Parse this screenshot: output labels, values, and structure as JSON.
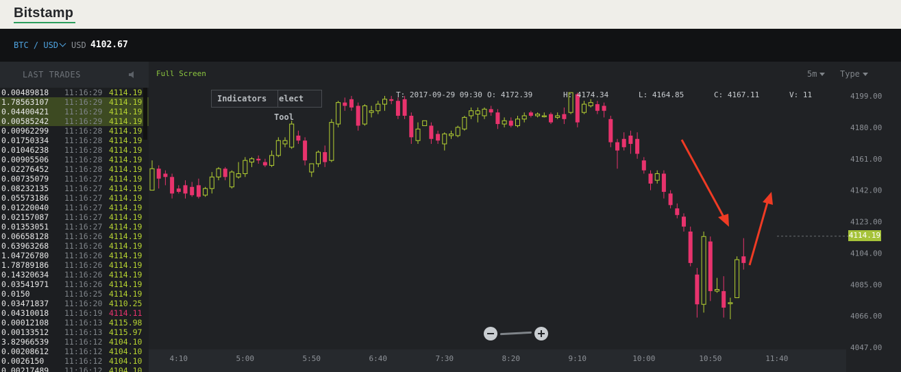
{
  "header": {
    "logo": "Bitstamp"
  },
  "pair_bar": {
    "pair": "BTC / USD",
    "currency": "USD",
    "price": "4102.67"
  },
  "last_trades": {
    "title": "LAST TRADES",
    "rows": [
      {
        "amount": "0.00489818",
        "time": "11:16:29",
        "price": "4114.19",
        "dir": "up",
        "highlight": false
      },
      {
        "amount": "1.78563107",
        "time": "11:16:29",
        "price": "4114.19",
        "dir": "up",
        "highlight": true
      },
      {
        "amount": "0.04400421",
        "time": "11:16:29",
        "price": "4114.19",
        "dir": "up",
        "highlight": true
      },
      {
        "amount": "0.00585242",
        "time": "11:16:29",
        "price": "4114.19",
        "dir": "up",
        "highlight": true
      },
      {
        "amount": "0.00962299",
        "time": "11:16:28",
        "price": "4114.19",
        "dir": "up",
        "highlight": false
      },
      {
        "amount": "0.01750334",
        "time": "11:16:28",
        "price": "4114.19",
        "dir": "up",
        "highlight": false
      },
      {
        "amount": "0.01046238",
        "time": "11:16:28",
        "price": "4114.19",
        "dir": "up",
        "highlight": false
      },
      {
        "amount": "0.00905506",
        "time": "11:16:28",
        "price": "4114.19",
        "dir": "up",
        "highlight": false
      },
      {
        "amount": "0.02276452",
        "time": "11:16:28",
        "price": "4114.19",
        "dir": "up",
        "highlight": false
      },
      {
        "amount": "0.00735079",
        "time": "11:16:27",
        "price": "4114.19",
        "dir": "up",
        "highlight": false
      },
      {
        "amount": "0.08232135",
        "time": "11:16:27",
        "price": "4114.19",
        "dir": "up",
        "highlight": false
      },
      {
        "amount": "0.05573186",
        "time": "11:16:27",
        "price": "4114.19",
        "dir": "up",
        "highlight": false
      },
      {
        "amount": "0.01220040",
        "time": "11:16:27",
        "price": "4114.19",
        "dir": "up",
        "highlight": false
      },
      {
        "amount": "0.02157087",
        "time": "11:16:27",
        "price": "4114.19",
        "dir": "up",
        "highlight": false
      },
      {
        "amount": "0.01353051",
        "time": "11:16:27",
        "price": "4114.19",
        "dir": "up",
        "highlight": false
      },
      {
        "amount": "0.06658128",
        "time": "11:16:26",
        "price": "4114.19",
        "dir": "up",
        "highlight": false
      },
      {
        "amount": "0.63963268",
        "time": "11:16:26",
        "price": "4114.19",
        "dir": "up",
        "highlight": false
      },
      {
        "amount": "1.04726780",
        "time": "11:16:26",
        "price": "4114.19",
        "dir": "up",
        "highlight": false
      },
      {
        "amount": "1.78789186",
        "time": "11:16:26",
        "price": "4114.19",
        "dir": "up",
        "highlight": false
      },
      {
        "amount": "0.14320634",
        "time": "11:16:26",
        "price": "4114.19",
        "dir": "up",
        "highlight": false
      },
      {
        "amount": "0.03541971",
        "time": "11:16:26",
        "price": "4114.19",
        "dir": "up",
        "highlight": false
      },
      {
        "amount": "0.0150",
        "time": "11:16:25",
        "price": "4114.19",
        "dir": "up",
        "highlight": false
      },
      {
        "amount": "0.03471837",
        "time": "11:16:20",
        "price": "4110.25",
        "dir": "up",
        "highlight": false
      },
      {
        "amount": "0.04310018",
        "time": "11:16:19",
        "price": "4114.11",
        "dir": "down",
        "highlight": false
      },
      {
        "amount": "0.00012108",
        "time": "11:16:13",
        "price": "4115.98",
        "dir": "up",
        "highlight": false
      },
      {
        "amount": "0.00133512",
        "time": "11:16:13",
        "price": "4115.97",
        "dir": "up",
        "highlight": false
      },
      {
        "amount": "3.82966539",
        "time": "11:16:12",
        "price": "4104.10",
        "dir": "up",
        "highlight": false
      },
      {
        "amount": "0.00208612",
        "time": "11:16:12",
        "price": "4104.10",
        "dir": "up",
        "highlight": false
      },
      {
        "amount": "0.0026150",
        "time": "11:16:12",
        "price": "4104.10",
        "dir": "up",
        "highlight": false
      },
      {
        "amount": "0.00217489",
        "time": "11:16:12",
        "price": "4104.10",
        "dir": "up",
        "highlight": false
      }
    ]
  },
  "toolbar": {
    "full_screen": "Full Screen",
    "interval": "5m",
    "type": "Type"
  },
  "indicators": {
    "label": "Indicators",
    "select": "elect",
    "tool": "Tool"
  },
  "ohlc": {
    "t": "T: 2017-09-29 09:30",
    "o": "O: 4172.39",
    "h": "H: 4174.34",
    "l": "L: 4164.85",
    "c": "C: 4167.11",
    "v": "V: 11"
  },
  "current_price_tag": "4114.19",
  "colors": {
    "up": "#b7d432",
    "down": "#e8336d",
    "background": "#202225",
    "annotation": "#ef3b24"
  },
  "chart_data": {
    "type": "candlestick",
    "y_ticks": [
      "4199.00",
      "4180.00",
      "4161.00",
      "4142.00",
      "4123.00",
      "4104.00",
      "4085.00",
      "4066.00",
      "4047.00"
    ],
    "x_ticks": [
      "4:10",
      "5:00",
      "5:50",
      "6:40",
      "7:30",
      "8:20",
      "9:10",
      "10:00",
      "10:50",
      "11:40"
    ],
    "ylim": [
      4047,
      4199
    ],
    "interval_minutes": 5,
    "current_price": 4114.19,
    "candles": [
      {
        "t": "3:50",
        "o": 4142,
        "h": 4160,
        "l": 4155,
        "c": 4155
      },
      {
        "t": "3:55",
        "o": 4155,
        "h": 4157,
        "l": 4143,
        "c": 4149
      },
      {
        "t": "4:00",
        "o": 4152,
        "h": 4154,
        "l": 4145,
        "c": 4150
      },
      {
        "t": "4:05",
        "o": 4150,
        "h": 4152,
        "l": 4137,
        "c": 4140
      },
      {
        "t": "4:10",
        "o": 4143,
        "h": 4145,
        "l": 4140,
        "c": 4141
      },
      {
        "t": "4:15",
        "o": 4145,
        "h": 4148,
        "l": 4137,
        "c": 4140
      },
      {
        "t": "4:20",
        "o": 4144,
        "h": 4147,
        "l": 4138,
        "c": 4139
      },
      {
        "t": "4:25",
        "o": 4145,
        "h": 4149,
        "l": 4137,
        "c": 4138
      },
      {
        "t": "4:30",
        "o": 4139,
        "h": 4144,
        "l": 4138,
        "c": 4143
      },
      {
        "t": "4:35",
        "o": 4143,
        "h": 4153,
        "l": 4140,
        "c": 4150
      },
      {
        "t": "4:40",
        "o": 4150,
        "h": 4156,
        "l": 4148,
        "c": 4155
      },
      {
        "t": "4:45",
        "o": 4155,
        "h": 4156,
        "l": 4148,
        "c": 4150
      },
      {
        "t": "4:50",
        "o": 4144,
        "h": 4154,
        "l": 4143,
        "c": 4153
      },
      {
        "t": "4:55",
        "o": 4150,
        "h": 4159,
        "l": 4149,
        "c": 4152
      },
      {
        "t": "5:00",
        "o": 4152,
        "h": 4162,
        "l": 4150,
        "c": 4160
      },
      {
        "t": "5:05",
        "o": 4159,
        "h": 4162,
        "l": 4156,
        "c": 4161
      },
      {
        "t": "5:10",
        "o": 4161,
        "h": 4163,
        "l": 4158,
        "c": 4160
      },
      {
        "t": "5:15",
        "o": 4159,
        "h": 4161,
        "l": 4156,
        "c": 4157
      },
      {
        "t": "5:20",
        "o": 4157,
        "h": 4166,
        "l": 4156,
        "c": 4163
      },
      {
        "t": "5:25",
        "o": 4163,
        "h": 4174,
        "l": 4162,
        "c": 4172
      },
      {
        "t": "5:30",
        "o": 4170,
        "h": 4174,
        "l": 4168,
        "c": 4172
      },
      {
        "t": "5:35",
        "o": 4168,
        "h": 4184,
        "l": 4167,
        "c": 4182
      },
      {
        "t": "5:40",
        "o": 4175,
        "h": 4178,
        "l": 4170,
        "c": 4172
      },
      {
        "t": "5:45",
        "o": 4172,
        "h": 4174,
        "l": 4157,
        "c": 4160
      },
      {
        "t": "5:50",
        "o": 4153,
        "h": 4158,
        "l": 4150,
        "c": 4158
      },
      {
        "t": "5:55",
        "o": 4158,
        "h": 4166,
        "l": 4156,
        "c": 4165
      },
      {
        "t": "6:00",
        "o": 4165,
        "h": 4169,
        "l": 4156,
        "c": 4159
      },
      {
        "t": "6:05",
        "o": 4160,
        "h": 4185,
        "l": 4159,
        "c": 4183
      },
      {
        "t": "6:10",
        "o": 4182,
        "h": 4196,
        "l": 4180,
        "c": 4195
      },
      {
        "t": "6:15",
        "o": 4195,
        "h": 4198,
        "l": 4190,
        "c": 4193
      },
      {
        "t": "6:20",
        "o": 4197,
        "h": 4199,
        "l": 4190,
        "c": 4192
      },
      {
        "t": "6:25",
        "o": 4193,
        "h": 4195,
        "l": 4178,
        "c": 4181
      },
      {
        "t": "6:30",
        "o": 4182,
        "h": 4194,
        "l": 4181,
        "c": 4193
      },
      {
        "t": "6:35",
        "o": 4189,
        "h": 4193,
        "l": 4186,
        "c": 4190
      },
      {
        "t": "6:40",
        "o": 4190,
        "h": 4196,
        "l": 4188,
        "c": 4194
      },
      {
        "t": "6:45",
        "o": 4194,
        "h": 4199,
        "l": 4190,
        "c": 4197
      },
      {
        "t": "6:50",
        "o": 4197,
        "h": 4199,
        "l": 4194,
        "c": 4196
      },
      {
        "t": "6:55",
        "o": 4196,
        "h": 4198,
        "l": 4185,
        "c": 4187
      },
      {
        "t": "7:00",
        "o": 4197,
        "h": 4199,
        "l": 4185,
        "c": 4187
      },
      {
        "t": "7:05",
        "o": 4187,
        "h": 4189,
        "l": 4170,
        "c": 4174
      },
      {
        "t": "7:10",
        "o": 4172,
        "h": 4183,
        "l": 4170,
        "c": 4179
      },
      {
        "t": "7:15",
        "o": 4181,
        "h": 4184,
        "l": 4181,
        "c": 4184
      },
      {
        "t": "7:20",
        "o": 4181,
        "h": 4183,
        "l": 4170,
        "c": 4173
      },
      {
        "t": "7:25",
        "o": 4176,
        "h": 4178,
        "l": 4170,
        "c": 4172
      },
      {
        "t": "7:30",
        "o": 4170,
        "h": 4177,
        "l": 4166,
        "c": 4176
      },
      {
        "t": "7:35",
        "o": 4175,
        "h": 4178,
        "l": 4173,
        "c": 4176
      },
      {
        "t": "7:40",
        "o": 4175,
        "h": 4181,
        "l": 4174,
        "c": 4180
      },
      {
        "t": "7:45",
        "o": 4179,
        "h": 4187,
        "l": 4178,
        "c": 4186
      },
      {
        "t": "7:50",
        "o": 4187,
        "h": 4192,
        "l": 4185,
        "c": 4190
      },
      {
        "t": "7:55",
        "o": 4188,
        "h": 4192,
        "l": 4183,
        "c": 4190
      },
      {
        "t": "8:00",
        "o": 4187,
        "h": 4192,
        "l": 4185,
        "c": 4191
      },
      {
        "t": "8:05",
        "o": 4191,
        "h": 4193,
        "l": 4187,
        "c": 4189
      },
      {
        "t": "8:10",
        "o": 4189,
        "h": 4191,
        "l": 4179,
        "c": 4182
      },
      {
        "t": "8:15",
        "o": 4182,
        "h": 4186,
        "l": 4180,
        "c": 4184
      },
      {
        "t": "8:20",
        "o": 4184,
        "h": 4186,
        "l": 4180,
        "c": 4181
      },
      {
        "t": "8:25",
        "o": 4181,
        "h": 4187,
        "l": 4180,
        "c": 4185
      },
      {
        "t": "8:30",
        "o": 4185,
        "h": 4189,
        "l": 4183,
        "c": 4187
      },
      {
        "t": "8:35",
        "o": 4189,
        "h": 4190,
        "l": 4186,
        "c": 4187
      },
      {
        "t": "8:40",
        "o": 4187,
        "h": 4189,
        "l": 4186,
        "c": 4188
      },
      {
        "t": "8:45",
        "o": 4187,
        "h": 4189,
        "l": 4186,
        "c": 4187
      },
      {
        "t": "8:50",
        "o": 4188,
        "h": 4189,
        "l": 4182,
        "c": 4183
      },
      {
        "t": "8:55",
        "o": 4186,
        "h": 4189,
        "l": 4185,
        "c": 4187
      },
      {
        "t": "9:00",
        "o": 4188,
        "h": 4192,
        "l": 4182,
        "c": 4185
      },
      {
        "t": "9:05",
        "o": 4189,
        "h": 4201,
        "l": 4188,
        "c": 4201
      },
      {
        "t": "9:10",
        "o": 4200,
        "h": 4201,
        "l": 4180,
        "c": 4183
      },
      {
        "t": "9:15",
        "o": 4189,
        "h": 4196,
        "l": 4188,
        "c": 4194
      },
      {
        "t": "9:20",
        "o": 4193,
        "h": 4197,
        "l": 4192,
        "c": 4195
      },
      {
        "t": "9:25",
        "o": 4194,
        "h": 4196,
        "l": 4188,
        "c": 4190
      },
      {
        "t": "9:30",
        "o": 4193,
        "h": 4195,
        "l": 4186,
        "c": 4190
      },
      {
        "t": "9:35",
        "o": 4185,
        "h": 4187,
        "l": 4168,
        "c": 4171
      },
      {
        "t": "9:40",
        "o": 4171,
        "h": 4173,
        "l": 4155,
        "c": 4166
      },
      {
        "t": "9:45",
        "o": 4173,
        "h": 4177,
        "l": 4166,
        "c": 4168
      },
      {
        "t": "9:50",
        "o": 4175,
        "h": 4178,
        "l": 4164,
        "c": 4170
      },
      {
        "t": "9:55",
        "o": 4173,
        "h": 4177,
        "l": 4161,
        "c": 4164
      },
      {
        "t": "10:00",
        "o": 4160,
        "h": 4162,
        "l": 4152,
        "c": 4154
      },
      {
        "t": "10:05",
        "o": 4152,
        "h": 4154,
        "l": 4142,
        "c": 4146
      },
      {
        "t": "10:10",
        "o": 4148,
        "h": 4154,
        "l": 4146,
        "c": 4152
      },
      {
        "t": "10:15",
        "o": 4152,
        "h": 4154,
        "l": 4137,
        "c": 4141
      },
      {
        "t": "10:20",
        "o": 4140,
        "h": 4142,
        "l": 4131,
        "c": 4133
      },
      {
        "t": "10:25",
        "o": 4131,
        "h": 4134,
        "l": 4125,
        "c": 4127
      },
      {
        "t": "10:30",
        "o": 4126,
        "h": 4128,
        "l": 4117,
        "c": 4120
      },
      {
        "t": "10:35",
        "o": 4117,
        "h": 4120,
        "l": 4096,
        "c": 4098
      },
      {
        "t": "10:40",
        "o": 4091,
        "h": 4095,
        "l": 4065,
        "c": 4073
      },
      {
        "t": "10:45",
        "o": 4073,
        "h": 4117,
        "l": 4068,
        "c": 4114
      },
      {
        "t": "10:50",
        "o": 4111,
        "h": 4114,
        "l": 4075,
        "c": 4081
      },
      {
        "t": "10:55",
        "o": 4081,
        "h": 4089,
        "l": 4080,
        "c": 4082
      },
      {
        "t": "11:00",
        "o": 4081,
        "h": 4090,
        "l": 4065,
        "c": 4071
      },
      {
        "t": "11:05",
        "o": 4074,
        "h": 4077,
        "l": 4064,
        "c": 4074
      },
      {
        "t": "11:10",
        "o": 4077,
        "h": 4102,
        "l": 4077,
        "c": 4100
      },
      {
        "t": "11:15",
        "o": 4102,
        "h": 4113,
        "l": 4094,
        "c": 4098
      }
    ]
  }
}
